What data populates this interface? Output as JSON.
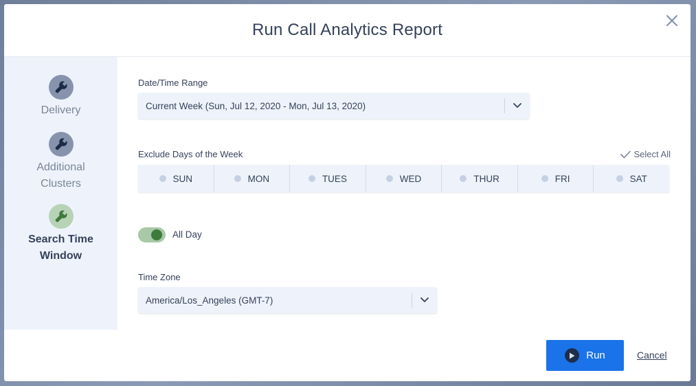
{
  "dialog": {
    "title": "Run Call Analytics Report"
  },
  "sidebar": {
    "steps": [
      {
        "label_line1": "Delivery",
        "label_line2": "",
        "state": "inactive"
      },
      {
        "label_line1": "Additional",
        "label_line2": "Clusters",
        "state": "inactive"
      },
      {
        "label_line1": "Search Time",
        "label_line2": "Window",
        "state": "active"
      }
    ]
  },
  "date_range": {
    "label": "Date/Time Range",
    "value": "Current Week (Sun, Jul 12, 2020 - Mon, Jul 13, 2020)"
  },
  "exclude_days": {
    "label": "Exclude Days of the Week",
    "select_all": "Select All",
    "days": [
      "SUN",
      "MON",
      "TUES",
      "WED",
      "THUR",
      "FRI",
      "SAT"
    ]
  },
  "all_day": {
    "label": "All Day",
    "enabled": true
  },
  "time_zone": {
    "label": "Time Zone",
    "value": "America/Los_Angeles (GMT-7)"
  },
  "footer": {
    "run_label": "Run",
    "cancel_label": "Cancel"
  },
  "colors": {
    "accent": "#1a73e8",
    "toggle_on": "#3e7a3b",
    "active_step": "#b7d3b6",
    "inactive_step": "#8793ad"
  },
  "icons": {
    "close": "close-icon",
    "step": "wrench-icon",
    "dropdown": "chevron-down-icon",
    "select_all": "checkmark-icon",
    "run": "play-icon"
  }
}
